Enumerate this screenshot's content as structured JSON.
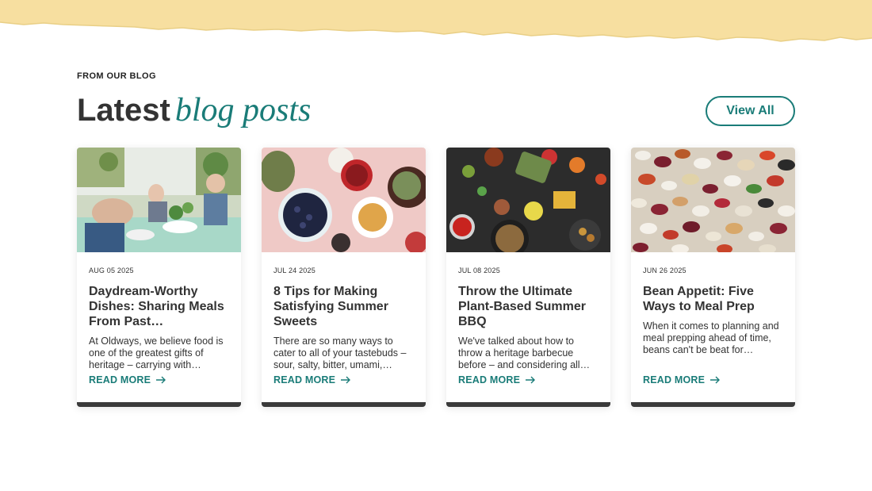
{
  "section": {
    "eyebrow": "FROM OUR BLOG",
    "title_plain": "Latest",
    "title_accent": "blog posts",
    "view_all_label": "View All"
  },
  "colors": {
    "accent": "#1a7c78",
    "band": "#f7dfa0",
    "text": "#333333",
    "card_footer": "#3a3a3a"
  },
  "posts": [
    {
      "date": "AUG 05 2025",
      "title": "Daydream-Worthy Dishes: Sharing Meals From Past…",
      "excerpt": "At Oldways, we believe food is one of the greatest gifts of heritage – carrying with…",
      "read_more": "READ MORE",
      "image": "elderly-friends-sharing-meal-photo"
    },
    {
      "date": "JUL 24 2025",
      "title": "8 Tips for Making Satisfying Summer Sweets",
      "excerpt": "There are so many ways to cater to all of your tastebuds – sour, salty, bitter, umami,…",
      "read_more": "READ MORE",
      "image": "blueberries-tea-table-photo"
    },
    {
      "date": "JUL 08 2025",
      "title": "Throw the Ultimate Plant-Based Summer BBQ",
      "excerpt": "We've talked about how to throw a heritage barbecue before – and considering all…",
      "read_more": "READ MORE",
      "image": "grilled-vegetables-bbq-photo"
    },
    {
      "date": "JUN 26 2025",
      "title": "Bean Appetit: Five Ways to Meal Prep with Beans",
      "excerpt": "When it comes to planning and meal prepping ahead of time, beans can't be beat for…",
      "read_more": "READ MORE",
      "image": "mixed-dry-beans-photo"
    }
  ]
}
